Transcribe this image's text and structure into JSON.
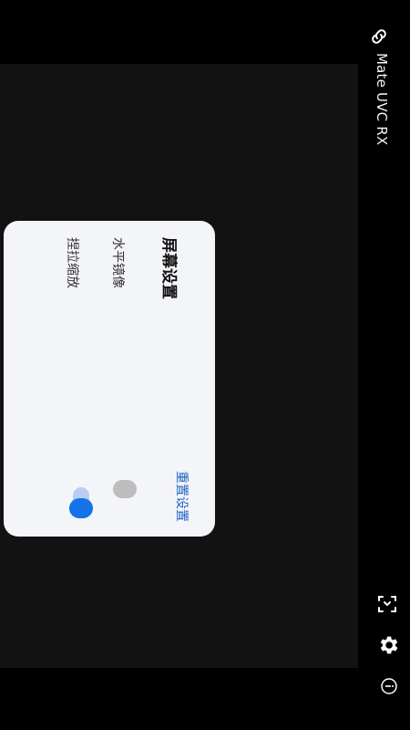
{
  "app": {
    "title": "Mate UVC RX"
  },
  "settings_panel": {
    "title": "屏幕设置",
    "reset_label": "重置设置",
    "items": [
      {
        "label": "水平镜像",
        "enabled": false
      },
      {
        "label": "捏拉缩放",
        "enabled": true
      }
    ]
  },
  "toolbar": {
    "icons": [
      "link-icon",
      "fit-screen-icon",
      "gear-icon",
      "info-icon"
    ]
  },
  "colors": {
    "accent": "#1473e6",
    "link": "#1a63c7",
    "background": "#121212"
  }
}
